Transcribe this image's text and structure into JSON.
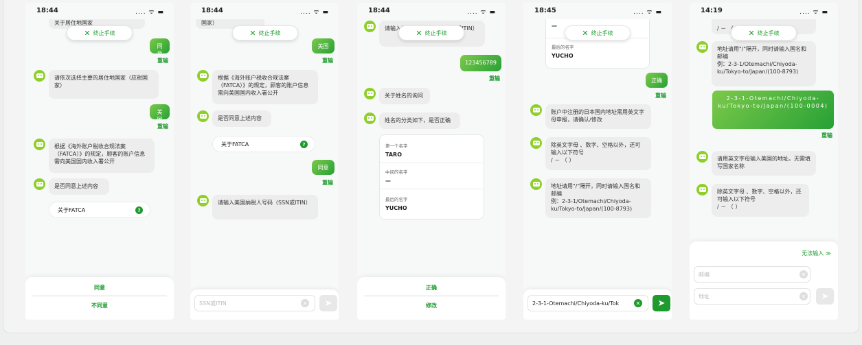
{
  "abort_label": "终止手续",
  "abort_icon": "close-icon",
  "redo_label": "重输",
  "accent_color": "#1e9a2e",
  "screens": [
    {
      "time": "18:44",
      "top_partial": "关于居住地国家",
      "user1": "同意",
      "bot1": "请依次选择主要的居住地国家（应税国家）",
      "user2": "美国",
      "bot2": "根据《海外账户税收合规法案（FATCA）》的规定，顾客的账户信息需向美国国内收入署公开",
      "bot3": "是否同意上述内容",
      "fatca": "关于FATCA",
      "options": [
        "同意",
        "不同意"
      ]
    },
    {
      "time": "18:44",
      "top_partial": "国家）",
      "user1": "美国",
      "bot1": "根据《海外账户税收合规法案（FATCA）》的规定，顾客的账户信息需向美国国内收入署公开",
      "bot2": "是否同意上述内容",
      "fatca": "关于FATCA",
      "user2": "同意",
      "bot3": "请输入美国纳税人号码（SSN或ITIN）",
      "input_placeholder": "SSN或ITIN"
    },
    {
      "time": "18:44",
      "bot0": "请输入美国纳税人号码（SSN或ITIN）",
      "user1": "123456789",
      "bot1": "关于姓名的询问",
      "bot2": "姓名的分类如下，是否正确",
      "card": [
        {
          "label": "第一个名字",
          "value": "TARO"
        },
        {
          "label": "中间的名字",
          "value": "—"
        },
        {
          "label": "最后的名字",
          "value": "YUCHO"
        }
      ],
      "options": [
        "正确",
        "修改"
      ]
    },
    {
      "time": "18:45",
      "card": [
        {
          "label": "",
          "value": "—"
        },
        {
          "label": "最后的名字",
          "value": "YUCHO"
        }
      ],
      "user1": "正确",
      "bot1": "账户中注册的日本国内地址需用英文字母申报，请确认/修改",
      "bot2": "除英文字母 、数字、空格以外，还可输入以下符号\n/ － （ ）",
      "bot3": "地址请用\"/\"隔开，同时请输入国名和邮编\n例：2-3-1/Otemachi/Chiyoda-ku/Tokyo-to/Japan/(100-8793)",
      "input_value": "2-3-1-Otemachi/Chiyoda-ku/Tok"
    },
    {
      "time": "14:19",
      "top_partial": "/ － （ ）",
      "bot1": "地址请用\"/\"隔开，同时请输入国名和邮编\n例：2-3-1/Otemachi/Chiyoda-ku/Tokyo-to/Japan/(100-8793)",
      "user1": "2-3-1-Otemachi/Chiyoda-ku/Tokyo-to/Japan/(100-0004)",
      "bot2": "请用英文字母输入美国的地址。无需填写国家名称",
      "bot3": "除英文字母 、数字、空格以外，还可输入以下符号\n/ － （ ）",
      "cannot_input": "无法输入 ≫",
      "postal_placeholder": "邮编",
      "address_placeholder": "地址"
    }
  ]
}
